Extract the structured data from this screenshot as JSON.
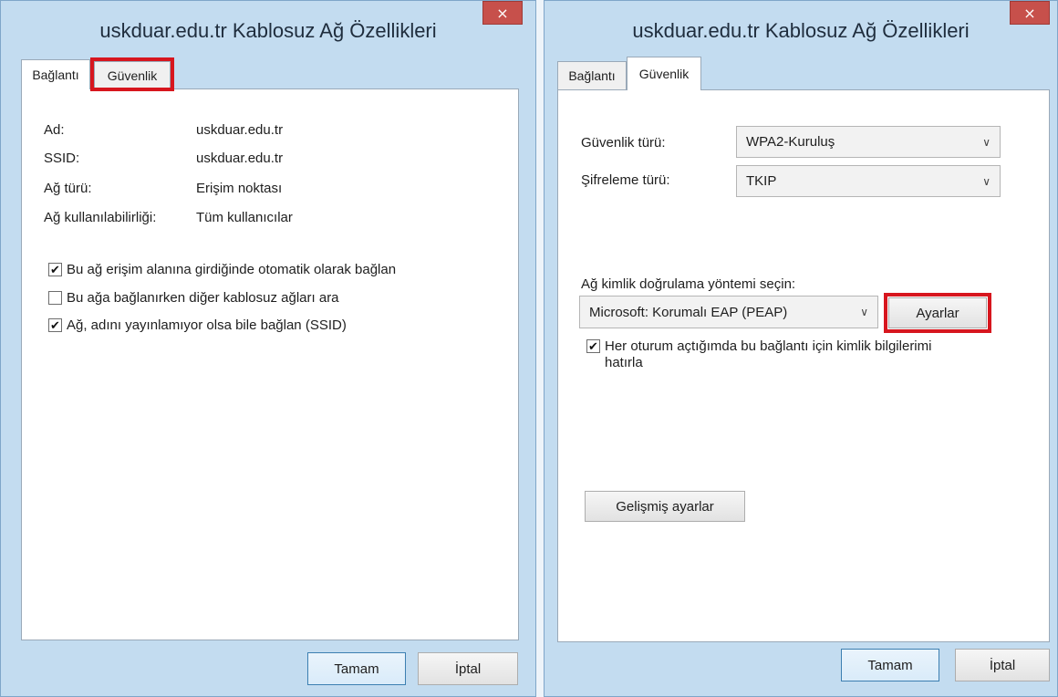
{
  "left_dialog": {
    "title": "uskduar.edu.tr Kablosuz Ağ Özellikleri",
    "close": "×",
    "tabs": [
      "Bağlantı",
      "Güvenlik"
    ],
    "fields": [
      {
        "label": "Ad:",
        "value": "uskduar.edu.tr"
      },
      {
        "label": "SSID:",
        "value": "uskduar.edu.tr"
      },
      {
        "label": "Ağ türü:",
        "value": "Erişim noktası"
      },
      {
        "label": "Ağ kullanılabilirliği:",
        "value": "Tüm kullanıcılar"
      }
    ],
    "checkboxes": [
      {
        "label": "Bu ağ erişim alanına girdiğinde otomatik olarak bağlan",
        "checked": true,
        "mark": "✔"
      },
      {
        "label": "Bu ağa bağlanırken diğer kablosuz ağları ara",
        "checked": false,
        "mark": ""
      },
      {
        "label": "Ağ, adını yayınlamıyor olsa bile bağlan (SSID)",
        "checked": true,
        "mark": "✔"
      }
    ],
    "ok": "Tamam",
    "cancel": "İptal"
  },
  "right_dialog": {
    "title": "uskduar.edu.tr Kablosuz Ağ Özellikleri",
    "close": "×",
    "tabs": [
      "Bağlantı",
      "Güvenlik"
    ],
    "security_type": {
      "label": "Güvenlik türü:",
      "value": "WPA2-Kuruluş"
    },
    "encryption_type": {
      "label": "Şifreleme türü:",
      "value": "TKIP"
    },
    "auth_method": {
      "label": "Ağ kimlik doğrulama yöntemi seçin:",
      "value": "Microsoft: Korumalı EAP (PEAP)"
    },
    "settings_button": "Ayarlar",
    "remember_checkbox": {
      "label": "Her oturum açtığımda bu bağlantı için kimlik bilgilerimi hatırla",
      "checked": true,
      "mark": "✔"
    },
    "advanced_button": "Gelişmiş ayarlar",
    "ok": "Tamam",
    "cancel": "İptal"
  },
  "icons": {
    "dropdown_arrow": "chevron-down-icon",
    "close": "close-icon",
    "check": "checkmark-icon"
  },
  "colors": {
    "highlight": "#d7161e",
    "window_frame": "#c3dcf0",
    "close_button": "#c7504b"
  }
}
